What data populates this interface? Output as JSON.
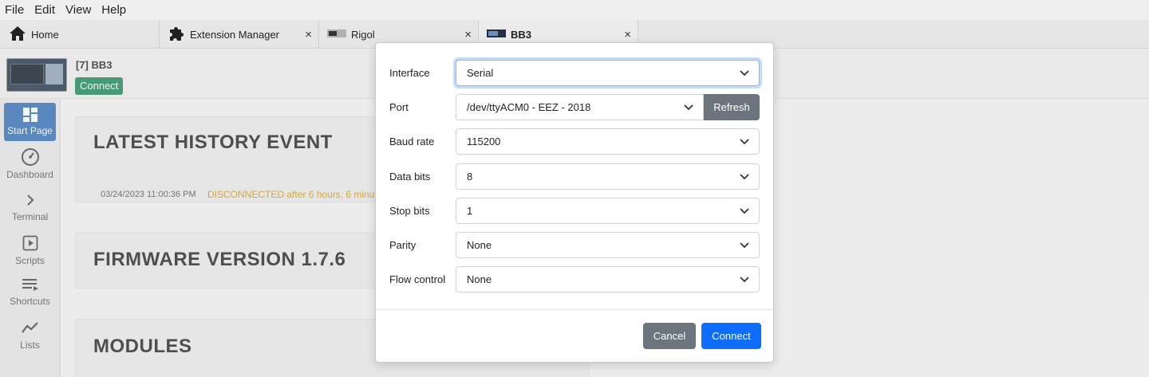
{
  "menubar": {
    "file": "File",
    "edit": "Edit",
    "view": "View",
    "help": "Help"
  },
  "tabs": [
    {
      "label": "Home",
      "icon": "home-icon"
    },
    {
      "label": "Extension Manager",
      "icon": "puzzle-icon",
      "close": "×"
    },
    {
      "label": "Rigol",
      "icon": "instrument-icon",
      "close": "×"
    },
    {
      "label": "BB3",
      "icon": "instrument-icon",
      "close": "×"
    }
  ],
  "instrument": {
    "title": "[7] BB3",
    "connect_label": "Connect"
  },
  "sidebar": {
    "items": [
      {
        "label": "Start Page",
        "icon": "grid-icon"
      },
      {
        "label": "Dashboard",
        "icon": "gauge-icon"
      },
      {
        "label": "Terminal",
        "icon": "chevron-right-icon"
      },
      {
        "label": "Scripts",
        "icon": "play-icon"
      },
      {
        "label": "Shortcuts",
        "icon": "list-icon"
      },
      {
        "label": "Lists",
        "icon": "chart-line-icon"
      }
    ]
  },
  "main": {
    "history": {
      "title": "LATEST HISTORY EVENT",
      "date": "03/24/2023 11:00:36 PM",
      "event": "DISCONNECTED after 6 hours, 6 minu"
    },
    "firmware": {
      "title": "FIRMWARE VERSION 1.7.6"
    },
    "modules": {
      "title": "MODULES"
    }
  },
  "dialog": {
    "fields": [
      {
        "label": "Interface",
        "value": "Serial"
      },
      {
        "label": "Port",
        "value": "/dev/ttyACM0 - EEZ - 2018"
      },
      {
        "label": "Baud rate",
        "value": "115200"
      },
      {
        "label": "Data bits",
        "value": "8"
      },
      {
        "label": "Stop bits",
        "value": "1"
      },
      {
        "label": "Parity",
        "value": "None"
      },
      {
        "label": "Flow control",
        "value": "None"
      }
    ],
    "refresh_label": "Refresh",
    "cancel_label": "Cancel",
    "connect_label": "Connect"
  },
  "colors": {
    "primary": "#0d6efd",
    "secondary": "#6c757d",
    "success": "#198754",
    "warning_text": "#d59a00",
    "sidebar_active": "#2f6fb6"
  }
}
